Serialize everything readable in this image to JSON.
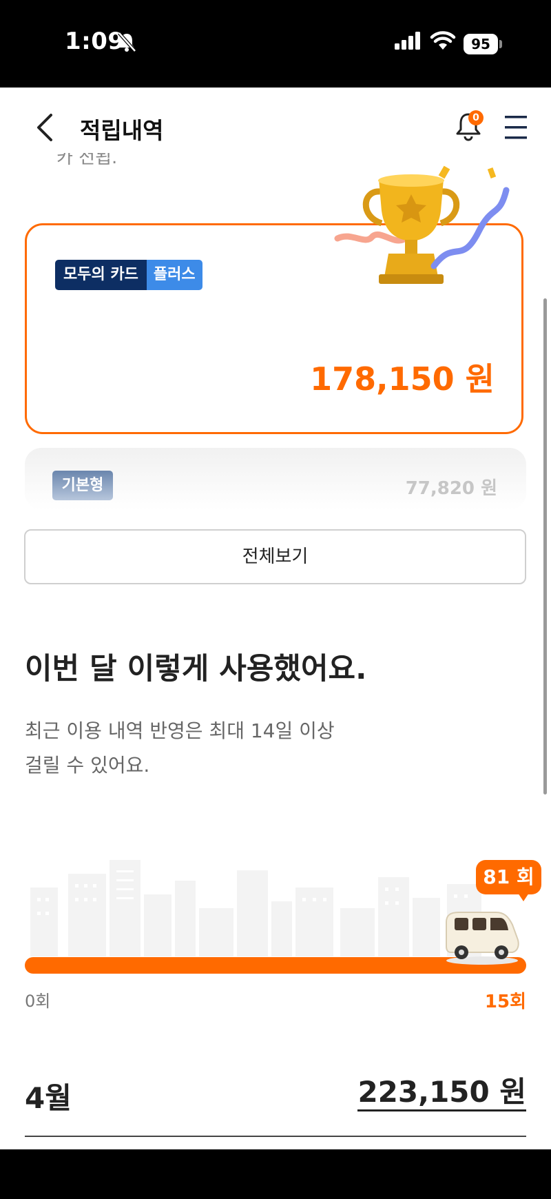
{
  "status_bar": {
    "time": "1:09",
    "battery": "95"
  },
  "header": {
    "title": "적립내역",
    "notification_count": "0"
  },
  "peek_text": "카 전됩.",
  "card_plus": {
    "tag_primary": "모두의 카드",
    "tag_secondary": "플러스",
    "amount": "178,150 원"
  },
  "card_basic": {
    "tag": "기본형",
    "amount": "77,820 원"
  },
  "view_all_label": "전체보기",
  "usage": {
    "heading": "이번 달 이렇게 사용했어요.",
    "subtext_line1": "최근 이용 내역 반영은 최대 14일 이상",
    "subtext_line2": "걸릴 수 있어요.",
    "count_bubble": "81 회",
    "min_label": "0회",
    "max_label": "15회",
    "progress": 1.0
  },
  "month_summary": {
    "month": "4월",
    "amount": "223,150 원"
  },
  "colors": {
    "accent": "#ff6a00",
    "navy": "#0d2e63",
    "blue": "#3d8be8"
  }
}
